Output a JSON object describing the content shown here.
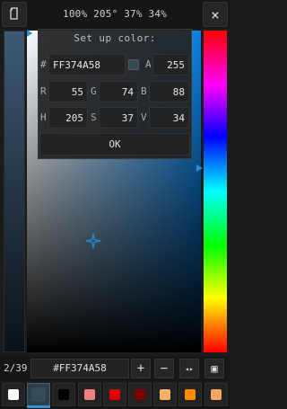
{
  "header": {
    "title": "100% 205° 37% 34%",
    "left_icon": "document-icon",
    "close_icon": "close-icon",
    "close_label": "×"
  },
  "dialog": {
    "title": "Set up color:",
    "hex_label": "#",
    "hex_value": "FF374A58",
    "alpha_label": "A",
    "alpha_value": "255",
    "r_label": "R",
    "r_value": "55",
    "g_label": "G",
    "g_value": "74",
    "b_label": "B",
    "b_value": "88",
    "h_label": "H",
    "h_value": "205",
    "s_label": "S",
    "s_value": "37",
    "v_label": "V",
    "v_value": "34",
    "ok_label": "OK",
    "preview_color": "#374A58"
  },
  "toolbar": {
    "page_counter": "2/39",
    "hex": "#FF374A58",
    "plus_label": "+",
    "minus_label": "−",
    "swap_label": "◂▸",
    "frame_label": "▣"
  },
  "swatches": {
    "colors": [
      "#ffffff",
      "#374A58",
      "#000000",
      "#f08080",
      "#e00000",
      "#7a0000",
      "#f6b26b",
      "#ff8c00",
      "#f4a460"
    ],
    "selected_index": 1
  }
}
